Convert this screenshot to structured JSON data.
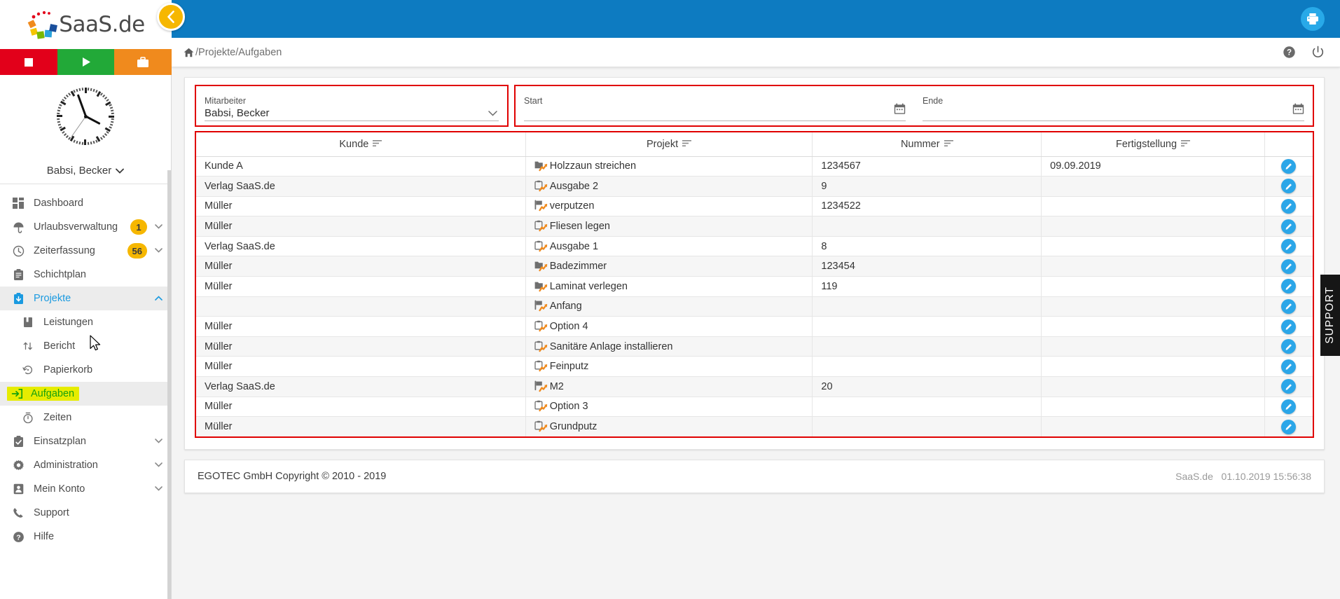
{
  "brand": {
    "name": "SaaS.de",
    "logo_icon": "saas-logo-icon"
  },
  "quickbar": [
    {
      "name": "stop-button",
      "icon": "stop-icon",
      "color": "#e2001a"
    },
    {
      "name": "start-button",
      "icon": "play-icon",
      "color": "#22a938"
    },
    {
      "name": "project-button",
      "icon": "briefcase-icon",
      "color": "#f08a1d"
    }
  ],
  "user": {
    "name": "Babsi, Becker",
    "chevron": "chevron-down-icon",
    "clock_icon": "analog-clock-icon"
  },
  "sidebar": {
    "items": [
      {
        "label": "Dashboard",
        "icon": "dashboard-icon",
        "badge": "",
        "chevron": "",
        "state": ""
      },
      {
        "label": "Urlaubsverwaltung",
        "icon": "umbrella-icon",
        "badge": "1",
        "chevron": "chevron-down-icon",
        "state": ""
      },
      {
        "label": "Zeiterfassung",
        "icon": "clock-icon",
        "badge": "56",
        "chevron": "chevron-down-icon",
        "state": ""
      },
      {
        "label": "Schichtplan",
        "icon": "clipboard-icon",
        "badge": "",
        "chevron": "",
        "state": ""
      },
      {
        "label": "Projekte",
        "icon": "projects-icon",
        "badge": "",
        "chevron": "chevron-up-icon",
        "state": "active-parent"
      },
      {
        "label": "Leistungen",
        "icon": "book-icon",
        "badge": "",
        "chevron": "",
        "state": "sub"
      },
      {
        "label": "Bericht",
        "icon": "sort-arrows-icon",
        "badge": "",
        "chevron": "",
        "state": "sub"
      },
      {
        "label": "Papierkorb",
        "icon": "restore-icon",
        "badge": "",
        "chevron": "",
        "state": "sub"
      },
      {
        "label": "Aufgaben",
        "icon": "tasks-icon",
        "badge": "",
        "chevron": "",
        "state": "sub highlighted"
      },
      {
        "label": "Zeiten",
        "icon": "stopwatch-icon",
        "badge": "",
        "chevron": "",
        "state": "sub"
      },
      {
        "label": "Einsatzplan",
        "icon": "checklist-icon",
        "badge": "",
        "chevron": "chevron-down-icon",
        "state": ""
      },
      {
        "label": "Administration",
        "icon": "gear-icon",
        "badge": "",
        "chevron": "chevron-down-icon",
        "state": ""
      },
      {
        "label": "Mein Konto",
        "icon": "person-icon",
        "badge": "",
        "chevron": "chevron-down-icon",
        "state": ""
      },
      {
        "label": "Support",
        "icon": "phone-icon",
        "badge": "",
        "chevron": "",
        "state": ""
      },
      {
        "label": "Hilfe",
        "icon": "help-icon",
        "badge": "",
        "chevron": "",
        "state": ""
      }
    ],
    "highlight_bg": "#e6ec00",
    "highlight_fg": "#16a10e",
    "badge_bg": "#f6b700"
  },
  "topbar": {
    "color": "#0d7bc1",
    "print_button_label": "print-icon",
    "collapse_button_icon": "chevron-left-icon"
  },
  "breadcrumb": {
    "home_icon": "home-icon",
    "path": "/Projekte/Aufgaben",
    "actions": [
      {
        "name": "help-icon",
        "label": "?"
      },
      {
        "name": "power-icon",
        "label": "power"
      }
    ]
  },
  "filters": {
    "employee": {
      "label": "Mitarbeiter",
      "value": "Babsi, Becker",
      "chevron": "chevron-down-icon"
    },
    "start": {
      "label": "Start",
      "value": "",
      "placeholder": "",
      "icon": "calendar-icon"
    },
    "end": {
      "label": "Ende",
      "value": "",
      "placeholder": "",
      "icon": "calendar-icon"
    }
  },
  "table": {
    "columns": [
      {
        "label": "Kunde",
        "sort_icon": "sort-icon"
      },
      {
        "label": "Projekt",
        "sort_icon": "sort-icon"
      },
      {
        "label": "Nummer",
        "sort_icon": "sort-icon"
      },
      {
        "label": "Fertigstellung",
        "sort_icon": "sort-icon"
      },
      {
        "label": "",
        "sort_icon": ""
      }
    ],
    "row_action_icon": "edit-pencil-icon",
    "rows": [
      {
        "kunde": "Kunde A",
        "projekt": "Holzzaun streichen",
        "projekt_icon": "folder-icon",
        "nummer": "1234567",
        "fertigstellung": "09.09.2019"
      },
      {
        "kunde": "Verlag SaaS.de",
        "projekt": "Ausgabe 2",
        "projekt_icon": "clipboard-icon",
        "nummer": "9",
        "fertigstellung": ""
      },
      {
        "kunde": "Müller",
        "projekt": "verputzen",
        "projekt_icon": "flag-icon",
        "nummer": "1234522",
        "fertigstellung": ""
      },
      {
        "kunde": "Müller",
        "projekt": "Fliesen legen",
        "projekt_icon": "clipboard-icon",
        "nummer": "",
        "fertigstellung": ""
      },
      {
        "kunde": "Verlag SaaS.de",
        "projekt": "Ausgabe 1",
        "projekt_icon": "clipboard-icon",
        "nummer": "8",
        "fertigstellung": ""
      },
      {
        "kunde": "Müller",
        "projekt": "Badezimmer",
        "projekt_icon": "folder-icon",
        "nummer": "123454",
        "fertigstellung": ""
      },
      {
        "kunde": "Müller",
        "projekt": "Laminat verlegen",
        "projekt_icon": "folder-icon",
        "nummer": "119",
        "fertigstellung": ""
      },
      {
        "kunde": "",
        "projekt": "Anfang",
        "projekt_icon": "flag-icon",
        "nummer": "",
        "fertigstellung": ""
      },
      {
        "kunde": "Müller",
        "projekt": "Option 4",
        "projekt_icon": "clipboard-icon",
        "nummer": "",
        "fertigstellung": ""
      },
      {
        "kunde": "Müller",
        "projekt": "Sanitäre Anlage installieren",
        "projekt_icon": "clipboard-icon",
        "nummer": "",
        "fertigstellung": ""
      },
      {
        "kunde": "Müller",
        "projekt": "Feinputz",
        "projekt_icon": "clipboard-icon",
        "nummer": "",
        "fertigstellung": ""
      },
      {
        "kunde": "Verlag SaaS.de",
        "projekt": "M2",
        "projekt_icon": "flag-icon",
        "nummer": "20",
        "fertigstellung": ""
      },
      {
        "kunde": "Müller",
        "projekt": "Option 3",
        "projekt_icon": "clipboard-icon",
        "nummer": "",
        "fertigstellung": ""
      },
      {
        "kunde": "Müller",
        "projekt": "Grundputz",
        "projekt_icon": "clipboard-icon",
        "nummer": "",
        "fertigstellung": ""
      }
    ]
  },
  "footer": {
    "copyright": "EGOTEC GmbH Copyright © 2010 - 2019",
    "app": "SaaS.de",
    "timestamp": "01.10.2019 15:56:38"
  },
  "support_tab": {
    "label": "SUPPORT"
  },
  "colors": {
    "accent_blue": "#0d7bc1",
    "link_blue": "#1a9ae0",
    "action_blue": "#2ba6e8",
    "highlight_border": "#e00000",
    "badge_yellow": "#f6b700",
    "icon_orange": "#f08a1d"
  }
}
